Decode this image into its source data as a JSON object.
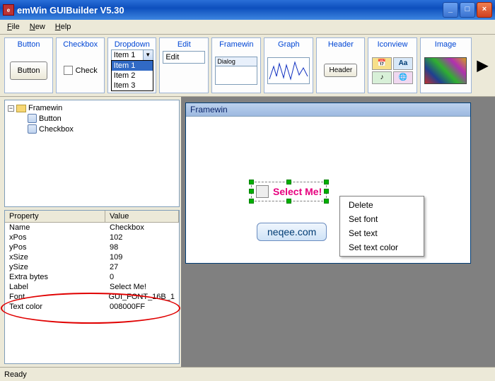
{
  "window": {
    "title": "emWin GUIBuilder V5.30"
  },
  "menus": {
    "file": "File",
    "new": "New",
    "help": "Help"
  },
  "toolbar": {
    "button": {
      "title": "Button",
      "label": "Button"
    },
    "checkbox": {
      "title": "Checkbox",
      "label": "Check"
    },
    "dropdown": {
      "title": "Dropdown",
      "selected": "Item 1",
      "opt1": "Item 1",
      "opt2": "Item 2",
      "opt3": "Item 3"
    },
    "edit": {
      "title": "Edit",
      "value": "Edit"
    },
    "framewin": {
      "title": "Framewin",
      "label": "Dialog"
    },
    "graph": {
      "title": "Graph"
    },
    "header": {
      "title": "Header",
      "label": "Header"
    },
    "iconview": {
      "title": "Iconview"
    },
    "image": {
      "title": "Image"
    }
  },
  "tree": {
    "root": "Framewin",
    "child1": "Button",
    "child2": "Checkbox"
  },
  "props": {
    "col_property": "Property",
    "col_value": "Value",
    "rows": [
      {
        "name": "Name",
        "value": "Checkbox"
      },
      {
        "name": "xPos",
        "value": "102"
      },
      {
        "name": "yPos",
        "value": "98"
      },
      {
        "name": "xSize",
        "value": "109"
      },
      {
        "name": "ySize",
        "value": "27"
      },
      {
        "name": "Extra bytes",
        "value": "0"
      },
      {
        "name": "Label",
        "value": "Select Me!"
      },
      {
        "name": "Font",
        "value": "GUI_FONT_16B_1"
      },
      {
        "name": "Text color",
        "value": "008000FF"
      }
    ]
  },
  "design": {
    "title": "Framewin",
    "checkbox_label": "Select Me!",
    "link_label": "neqee.com"
  },
  "ctx": {
    "delete": "Delete",
    "set_font": "Set font",
    "set_text": "Set text",
    "set_text_color": "Set text color"
  },
  "status": "Ready"
}
